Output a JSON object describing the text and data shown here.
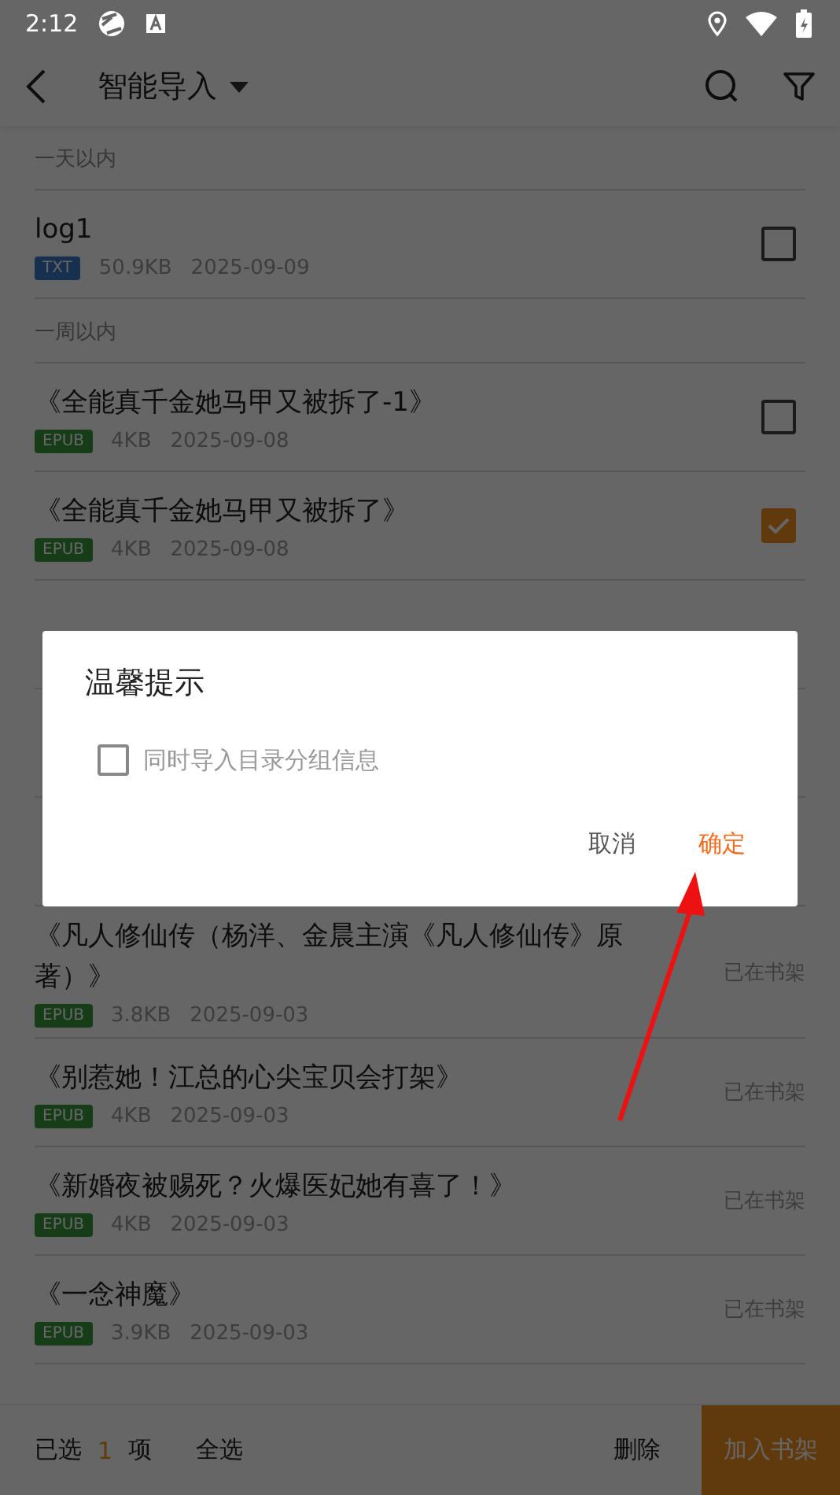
{
  "status_bar": {
    "time": "2:12"
  },
  "toolbar": {
    "title": "智能导入"
  },
  "sections": [
    {
      "header": "一天以内",
      "items": [
        {
          "kind": "file",
          "title": "log1",
          "tag": "TXT",
          "size": "50.9KB",
          "date": "2025-09-09",
          "checked": false
        }
      ]
    },
    {
      "header": "一周以内",
      "items": [
        {
          "kind": "file",
          "title": "《全能真千金她马甲又被拆了-1》",
          "tag": "EPUB",
          "size": "4KB",
          "date": "2025-09-08",
          "checked": false
        },
        {
          "kind": "file",
          "title": "《全能真千金她马甲又被拆了》",
          "tag": "EPUB",
          "size": "4KB",
          "date": "2025-09-08",
          "checked": true
        },
        {
          "kind": "covered"
        },
        {
          "kind": "covered"
        },
        {
          "kind": "covered"
        },
        {
          "kind": "file",
          "title": "《凡人修仙传（杨洋、金晨主演《凡人修仙传》原著）》",
          "tag": "EPUB",
          "size": "3.8KB",
          "date": "2025-09-03",
          "status_text": "已在书架"
        },
        {
          "kind": "file",
          "title": "《别惹她！江总的心尖宝贝会打架》",
          "tag": "EPUB",
          "size": "4KB",
          "date": "2025-09-03",
          "status_text": "已在书架"
        },
        {
          "kind": "file",
          "title": "《新婚夜被赐死？火爆医妃她有喜了！》",
          "tag": "EPUB",
          "size": "4KB",
          "date": "2025-09-03",
          "status_text": "已在书架"
        },
        {
          "kind": "file",
          "title": "《一念神魔》",
          "tag": "EPUB",
          "size": "3.9KB",
          "date": "2025-09-03",
          "status_text": "已在书架"
        }
      ]
    }
  ],
  "bottom_bar": {
    "selected_prefix": "已选",
    "selected_count": "1",
    "selected_suffix": "项",
    "select_all": "全选",
    "delete": "删除",
    "add": "加入书架"
  },
  "dialog": {
    "title": "温馨提示",
    "option": {
      "label": "同时导入目录分组信息",
      "checked": false
    },
    "buttons": [
      {
        "label": "取消",
        "kind": "cancel"
      },
      {
        "label": "确定",
        "kind": "confirm"
      }
    ]
  }
}
